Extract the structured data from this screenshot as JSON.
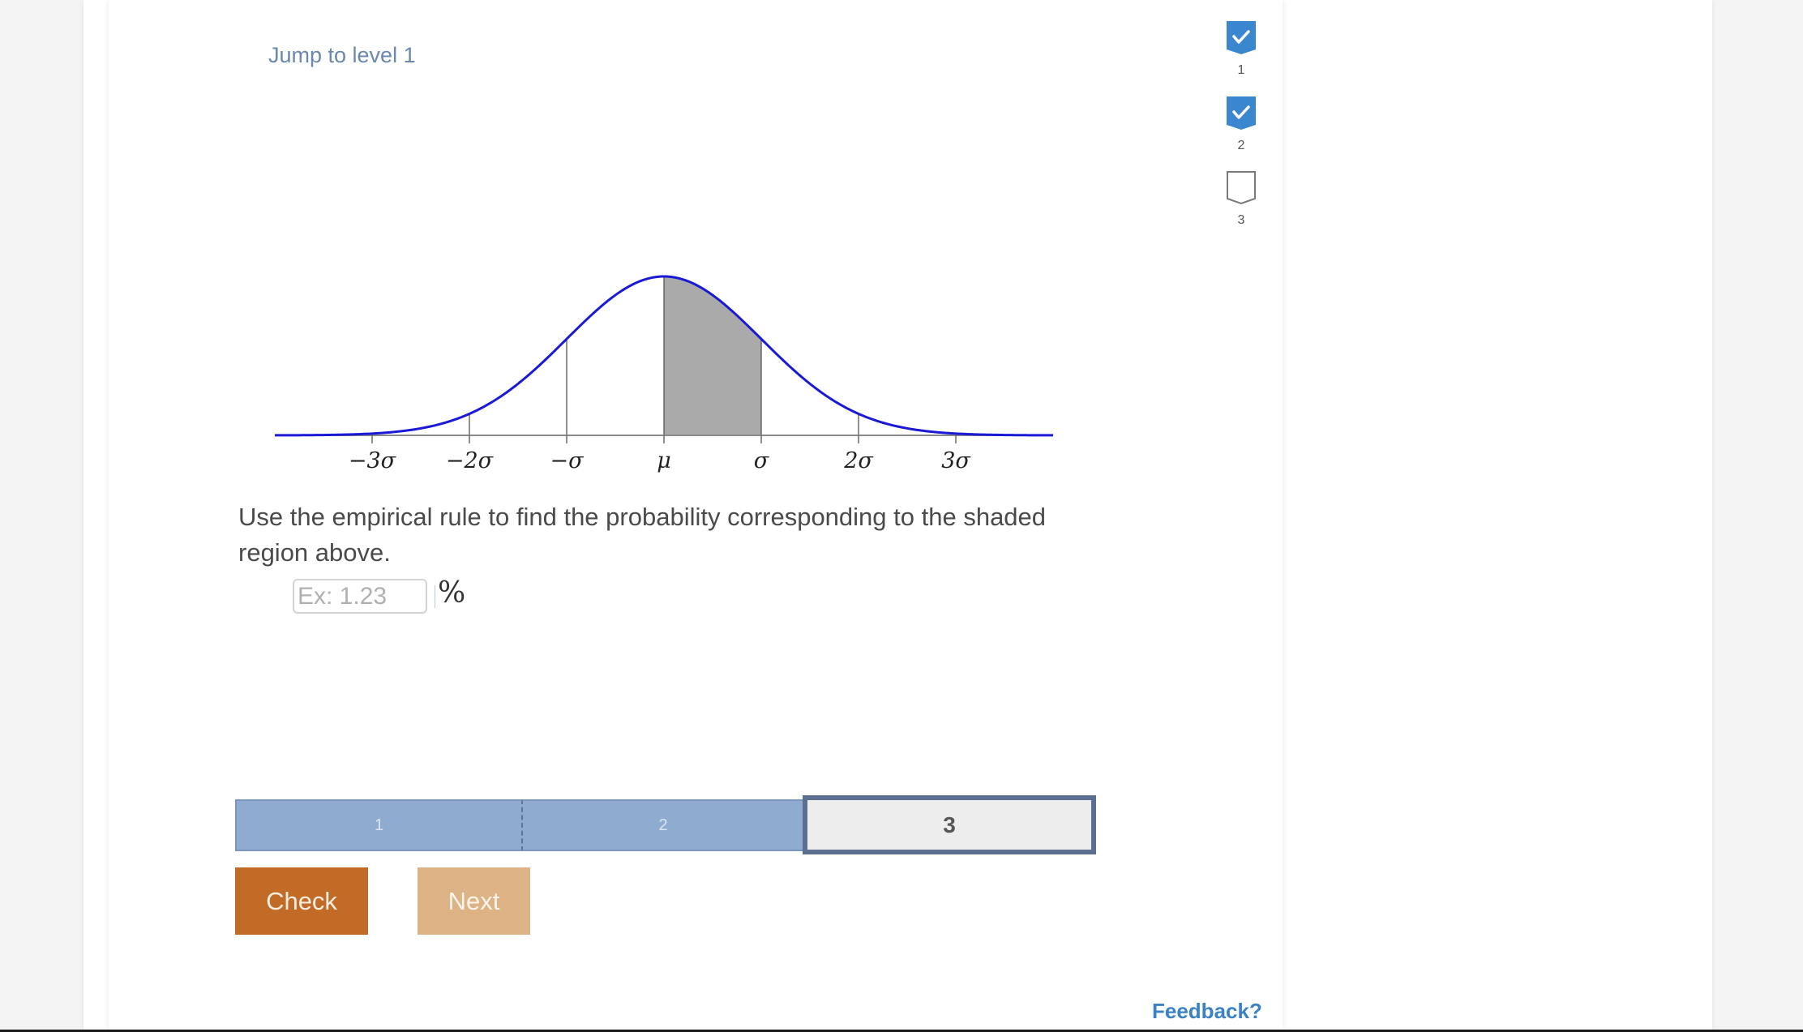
{
  "header": {
    "jump_link": "Jump to level 1"
  },
  "levels": [
    {
      "number": "1",
      "status": "completed",
      "icon": "check-icon"
    },
    {
      "number": "2",
      "status": "completed",
      "icon": "check-icon"
    },
    {
      "number": "3",
      "status": "incomplete",
      "icon": "empty-shield-icon"
    }
  ],
  "colors": {
    "level_complete": "#3a87d0",
    "level_incomplete_border": "#7a7a7a",
    "curve": "#1a1ad6",
    "shade": "#aaaaaa",
    "progress_done": "#8fabcf",
    "progress_current_border": "#5d6f90",
    "check_button": "#c16b27",
    "next_button": "#ddb386",
    "feedback_link": "#3b82c4"
  },
  "chart_data": {
    "type": "area",
    "title": "",
    "distribution": "normal",
    "xlabel": "",
    "ylabel": "",
    "x_range_sigma": [
      -4,
      4
    ],
    "ticks": [
      {
        "sigma": -3,
        "label": "−3σ"
      },
      {
        "sigma": -2,
        "label": "−2σ"
      },
      {
        "sigma": -1,
        "label": "−σ"
      },
      {
        "sigma": 0,
        "label": "μ"
      },
      {
        "sigma": 1,
        "label": "σ"
      },
      {
        "sigma": 2,
        "label": "2σ"
      },
      {
        "sigma": 3,
        "label": "3σ"
      }
    ],
    "vertical_lines_sigma": [
      -2,
      -1,
      0,
      1,
      2
    ],
    "shaded_region_sigma": [
      0,
      1
    ],
    "grid": false,
    "legend": "none"
  },
  "question": {
    "text": "Use the empirical rule to find the probability corresponding to the shaded region above.",
    "input_value": "",
    "input_placeholder": "Ex: 1.23",
    "unit": "%"
  },
  "progress": {
    "segments": [
      {
        "label": "1",
        "state": "done"
      },
      {
        "label": "2",
        "state": "done"
      },
      {
        "label": "3",
        "state": "current"
      }
    ]
  },
  "buttons": {
    "check": "Check",
    "next": "Next"
  },
  "footer": {
    "feedback": "Feedback?"
  }
}
